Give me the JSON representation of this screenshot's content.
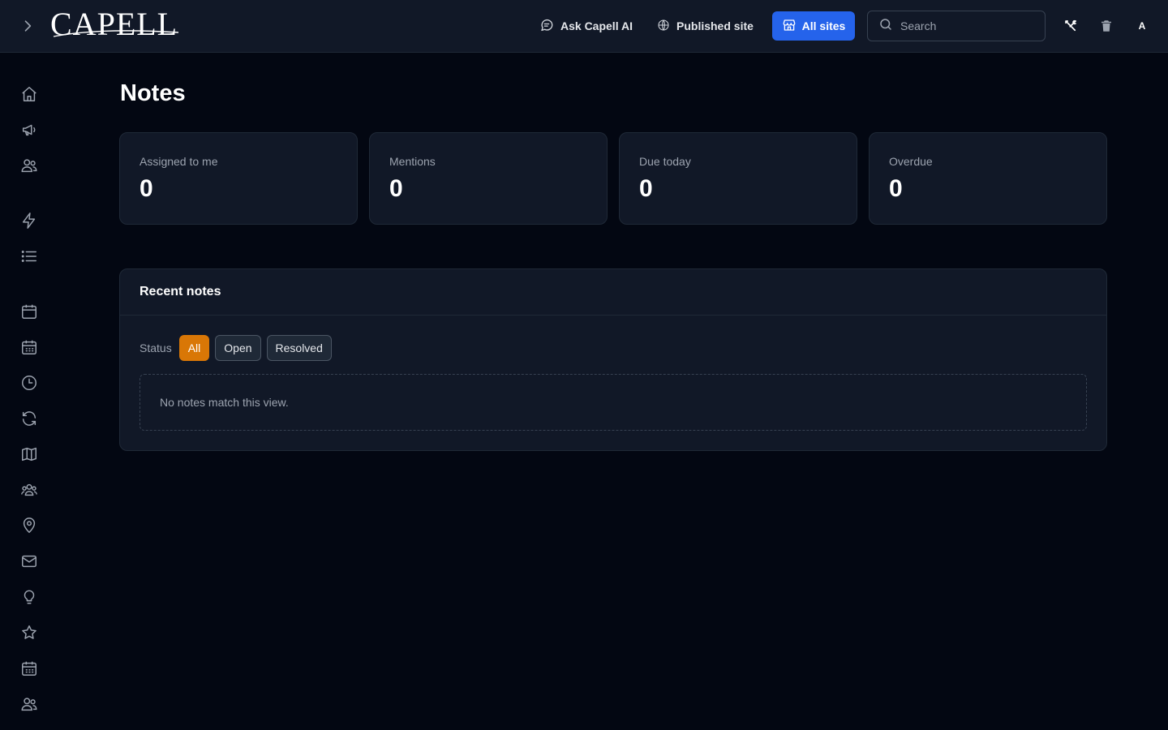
{
  "header": {
    "logo_text": "CAPELL",
    "ask_ai_label": "Ask Capell AI",
    "published_site_label": "Published site",
    "all_sites_label": "All sites",
    "search_placeholder": "Search",
    "avatar_initial": "A"
  },
  "sidebar": {
    "icons": [
      "home-icon",
      "megaphone-icon",
      "users-icon",
      "bolt-icon",
      "list-icon",
      "calendar-icon",
      "calendar-days-icon",
      "clock-icon",
      "refresh-icon",
      "map-icon",
      "user-group-icon",
      "map-pin-icon",
      "envelope-icon",
      "lightbulb-icon",
      "star-icon",
      "calendar-days-icon",
      "users-icon"
    ]
  },
  "page": {
    "title": "Notes",
    "stats": [
      {
        "label": "Assigned to me",
        "value": "0"
      },
      {
        "label": "Mentions",
        "value": "0"
      },
      {
        "label": "Due today",
        "value": "0"
      },
      {
        "label": "Overdue",
        "value": "0"
      }
    ],
    "recent": {
      "title": "Recent notes",
      "status_label": "Status",
      "filters": [
        "All",
        "Open",
        "Resolved"
      ],
      "active_filter": "All",
      "empty_text": "No notes match this view."
    }
  },
  "colors": {
    "accent": "#2563eb",
    "active_filter": "#d97706",
    "background": "#030712",
    "panel": "#111827"
  }
}
